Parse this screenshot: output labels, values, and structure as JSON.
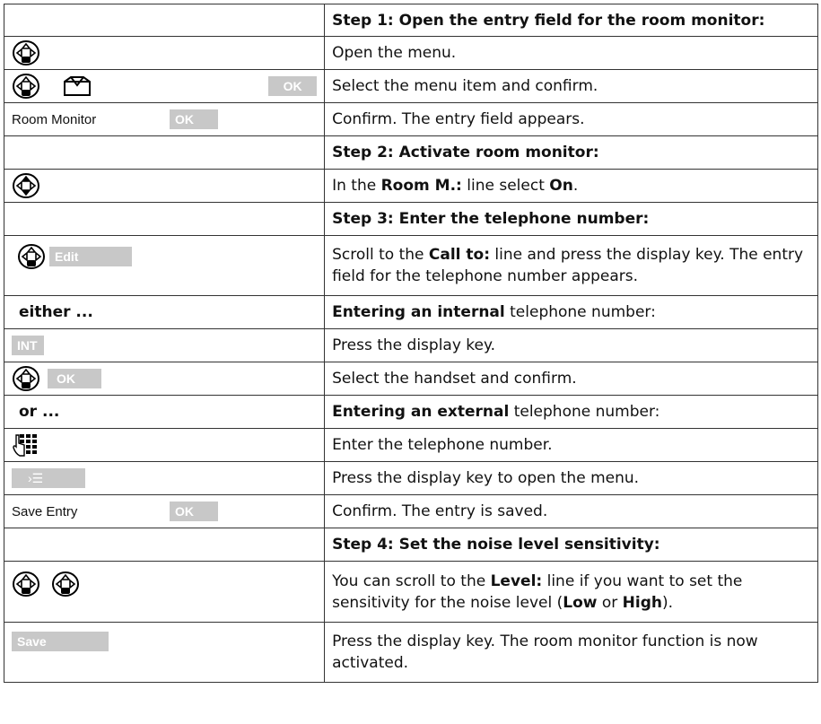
{
  "rows": {
    "step1_header": "Step 1: Open the entry field for the room monitor:",
    "r1_text": "Open the menu.",
    "r2_key": "OK",
    "r2_text": "Select the menu item and confirm.",
    "r3_display": "Room Monitor",
    "r3_key": "OK",
    "r3_text": "Confirm. The entry field appears.",
    "step2_header": "Step 2: Activate room monitor:",
    "r4_pre": "In the ",
    "r4_b1": "Room M.:",
    "r4_mid": " line select ",
    "r4_b2": "On",
    "r4_end": ".",
    "step3_header": "Step 3: Enter the telephone number:",
    "r5_key": "Edit",
    "r5_pre": "Scroll to the ",
    "r5_b1": "Call to:",
    "r5_post": " line and press the display key. The entry field for the telephone number appears.",
    "either_label": "either ...",
    "either_b": "Entering an internal",
    "either_post": " telephone number:",
    "r6_key": "INT",
    "r6_text": "Press the display key.",
    "r7_key": "OK",
    "r7_text": "Select the handset and confirm.",
    "or_label": "or ...",
    "or_b": "Entering an external",
    "or_post": " telephone number:",
    "r8_text": "Enter the telephone number.",
    "r9_key": "›☰",
    "r9_text": "Press the display key to open the menu.",
    "r10_display": "Save Entry",
    "r10_key": "OK",
    "r10_text": "Confirm. The entry is saved.",
    "step4_header": "Step 4: Set the noise level sensitivity:",
    "r11_pre": "You can scroll to the ",
    "r11_b1": "Level:",
    "r11_mid": " line if you want to set the sensitivity for the noise level (",
    "r11_b2": "Low",
    "r11_or": " or ",
    "r11_b3": "High",
    "r11_end": ").",
    "r12_key": "Save",
    "r12_text": "Press the display key. The room monitor function is now activated."
  },
  "icons": {
    "nav": "navigation-key-icon",
    "menu": "envelope-menu-icon",
    "keypad": "keypad-icon"
  }
}
